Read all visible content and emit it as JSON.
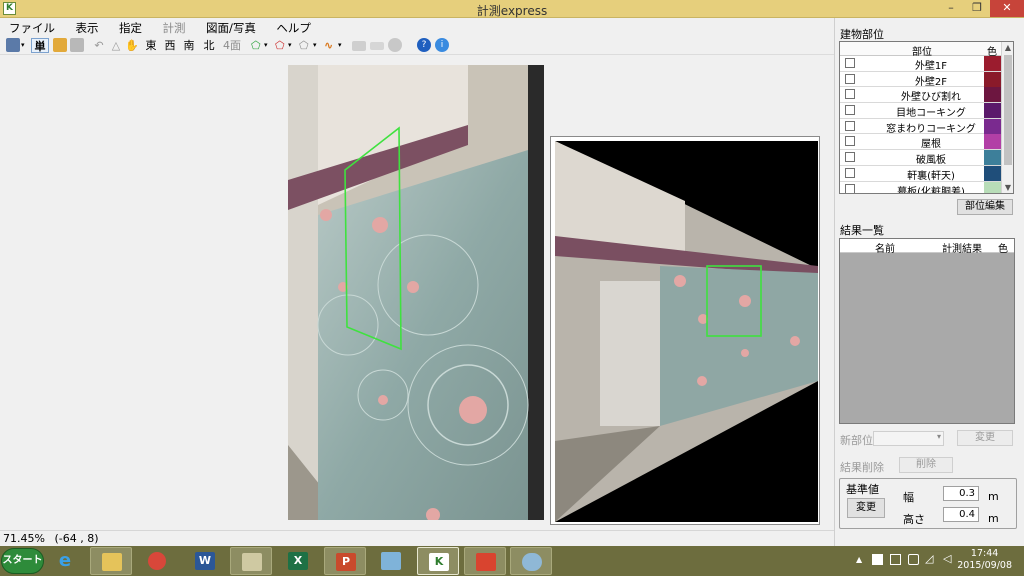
{
  "window": {
    "title": "計測express",
    "min": "–",
    "max": "❐",
    "close": "✕"
  },
  "menu": [
    "ファイル",
    "表示",
    "指定",
    "計測",
    "図面/写真",
    "ヘルプ"
  ],
  "toolbar": {
    "mode": "単",
    "directions": [
      "東",
      "西",
      "南",
      "北"
    ],
    "four_view": "4面"
  },
  "status": {
    "zoom": "71.45%",
    "coords": "(-64 , 8)"
  },
  "panel": {
    "parts_title": "建物部位",
    "parts_header_name": "部位",
    "parts_header_color": "色",
    "parts": [
      {
        "label": "外壁1F",
        "color": "#9b1c2e",
        "checked": false
      },
      {
        "label": "外壁2F",
        "color": "#8a1a2a",
        "checked": false
      },
      {
        "label": "外壁ひび割れ",
        "color": "#6d1640",
        "checked": false
      },
      {
        "label": "目地コーキング",
        "color": "#5b1a6b",
        "checked": false
      },
      {
        "label": "窓まわりコーキング",
        "color": "#7a2a8f",
        "checked": false
      },
      {
        "label": "屋根",
        "color": "#b23fa6",
        "checked": false
      },
      {
        "label": "破風板",
        "color": "#3d7f9a",
        "checked": false
      },
      {
        "label": "軒裏(軒天)",
        "color": "#1f4e7a",
        "checked": false
      },
      {
        "label": "幕板(化粧胴差)",
        "color": "#b8ddb8",
        "checked": false
      }
    ],
    "parts_edit": "部位編集",
    "results_title": "結果一覧",
    "results_header_name": "名前",
    "results_header_value": "計測結果",
    "results_header_color": "色",
    "new_part_label": "新部位",
    "change_button": "変更",
    "delete_label": "結果削除",
    "delete_button": "削除",
    "reference_title": "基準値",
    "reference_change": "変更",
    "width_label": "幅",
    "width_value": "0.3",
    "width_unit": "m",
    "height_label": "高さ",
    "height_value": "0.4",
    "height_unit": "m"
  },
  "taskbar": {
    "start": "スタート",
    "time": "17:44",
    "date": "2015/09/08"
  },
  "colors": {
    "accent_green": "#3fe23f",
    "titlebar": "#e6cf7c",
    "taskbar": "#6d6d3e"
  }
}
